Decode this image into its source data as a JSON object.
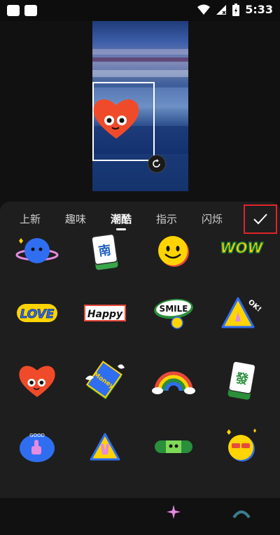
{
  "status_bar": {
    "time": "5:33"
  },
  "tabs": [
    {
      "label": "上新"
    },
    {
      "label": "趣味"
    },
    {
      "label": "潮酷"
    },
    {
      "label": "指示"
    },
    {
      "label": "闪烁"
    }
  ],
  "stickers": {
    "tile_mahjong": "南",
    "wow": "WOW",
    "love": "LOVE",
    "happy": "Happy",
    "smile": "SMILE",
    "ok": "OK!",
    "money": "Money",
    "fa_tile": "發",
    "good": "GOOD"
  },
  "colors": {
    "accent_border": "#e0242a",
    "panel_bg": "#1e1e1e"
  }
}
